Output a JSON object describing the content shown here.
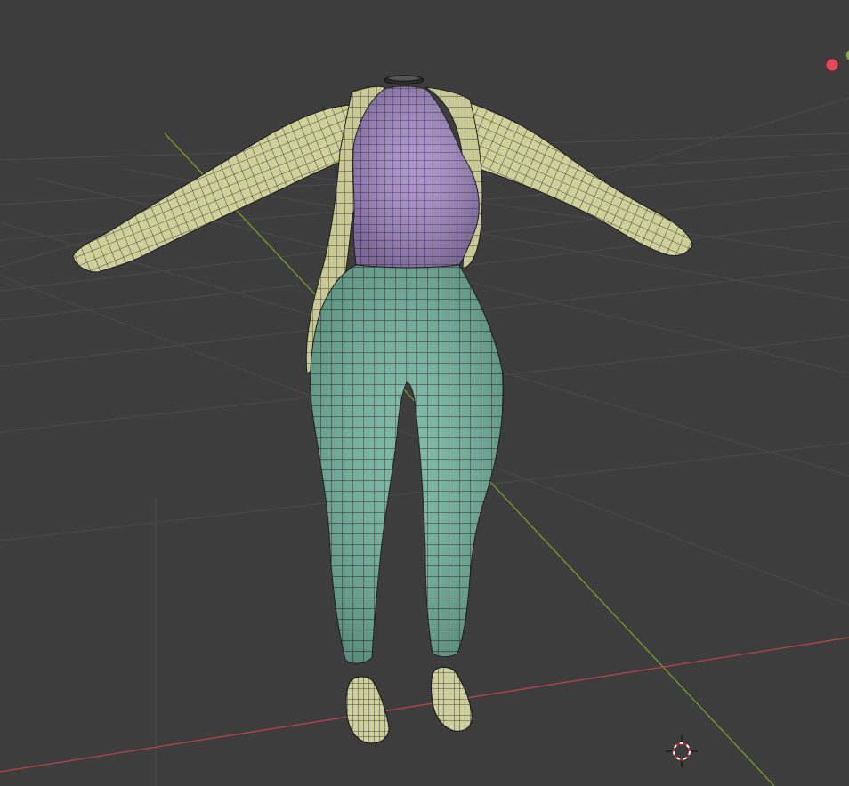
{
  "viewport": {
    "type": "3d-viewport",
    "background_color": "#3d3d3d",
    "grid_color": "#4b4b4b",
    "x_axis_color": "#b5454f",
    "y_axis_color": "#7a9a2d"
  },
  "scene": {
    "objects": [
      {
        "name": "jacket",
        "color": "#cfd09a"
      },
      {
        "name": "top",
        "color": "#a48ac8"
      },
      {
        "name": "leggings",
        "color": "#74b5a0"
      },
      {
        "name": "shoes",
        "color": "#cfd09a"
      }
    ],
    "wire_color": "#1e1e1e"
  },
  "gizmo": {
    "x_ball_color": "#e04a5a",
    "y_ball_color": "#8ab02e"
  },
  "cursor_3d": {
    "icon": "crosshair-target-icon",
    "ring_colors": [
      "#ffffff",
      "#d0202f"
    ]
  }
}
